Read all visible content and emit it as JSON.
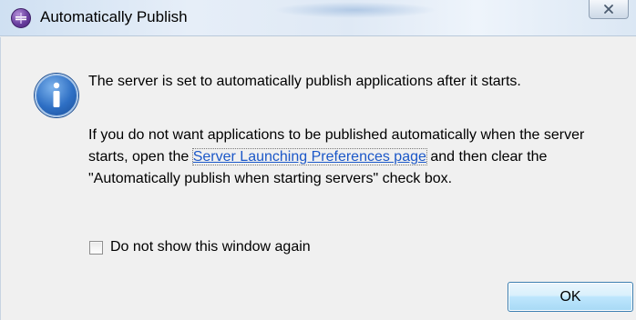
{
  "window": {
    "title": "Automatically Publish",
    "app_icon": "eclipse-app-icon",
    "close_icon": "close-icon"
  },
  "dialog": {
    "icon": "info-icon",
    "primary_message": "The server is set to automatically publish applications after it starts.",
    "detail_before_link": "If you do not want applications to be published automatically when the server starts, open the ",
    "link_text": "Server Launching Preferences page",
    "detail_after_link": " and then clear the \"Automatically publish when starting servers\" check box.",
    "checkbox_label": "Do not show this window again",
    "checkbox_checked": false,
    "ok_label": "OK"
  },
  "colors": {
    "link": "#1b57c8",
    "background": "#f0f0f0"
  }
}
